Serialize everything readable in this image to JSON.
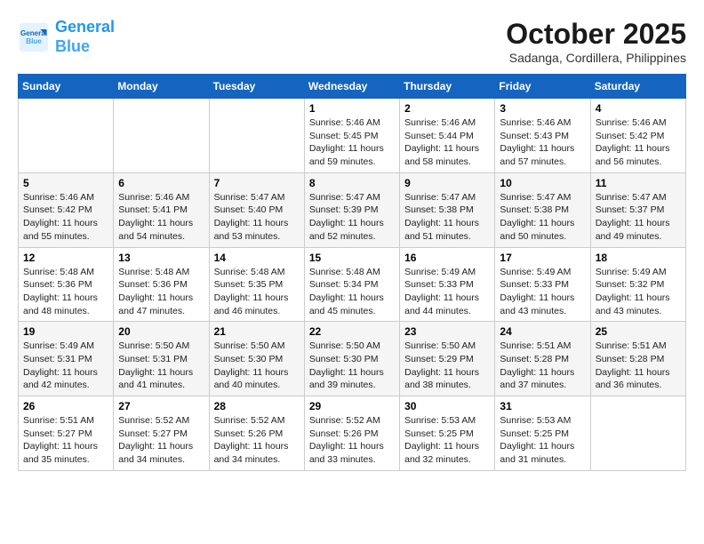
{
  "header": {
    "logo_line1": "General",
    "logo_line2": "Blue",
    "month": "October 2025",
    "location": "Sadanga, Cordillera, Philippines"
  },
  "weekdays": [
    "Sunday",
    "Monday",
    "Tuesday",
    "Wednesday",
    "Thursday",
    "Friday",
    "Saturday"
  ],
  "weeks": [
    [
      {
        "day": "",
        "info": ""
      },
      {
        "day": "",
        "info": ""
      },
      {
        "day": "",
        "info": ""
      },
      {
        "day": "1",
        "info": "Sunrise: 5:46 AM\nSunset: 5:45 PM\nDaylight: 11 hours\nand 59 minutes."
      },
      {
        "day": "2",
        "info": "Sunrise: 5:46 AM\nSunset: 5:44 PM\nDaylight: 11 hours\nand 58 minutes."
      },
      {
        "day": "3",
        "info": "Sunrise: 5:46 AM\nSunset: 5:43 PM\nDaylight: 11 hours\nand 57 minutes."
      },
      {
        "day": "4",
        "info": "Sunrise: 5:46 AM\nSunset: 5:42 PM\nDaylight: 11 hours\nand 56 minutes."
      }
    ],
    [
      {
        "day": "5",
        "info": "Sunrise: 5:46 AM\nSunset: 5:42 PM\nDaylight: 11 hours\nand 55 minutes."
      },
      {
        "day": "6",
        "info": "Sunrise: 5:46 AM\nSunset: 5:41 PM\nDaylight: 11 hours\nand 54 minutes."
      },
      {
        "day": "7",
        "info": "Sunrise: 5:47 AM\nSunset: 5:40 PM\nDaylight: 11 hours\nand 53 minutes."
      },
      {
        "day": "8",
        "info": "Sunrise: 5:47 AM\nSunset: 5:39 PM\nDaylight: 11 hours\nand 52 minutes."
      },
      {
        "day": "9",
        "info": "Sunrise: 5:47 AM\nSunset: 5:38 PM\nDaylight: 11 hours\nand 51 minutes."
      },
      {
        "day": "10",
        "info": "Sunrise: 5:47 AM\nSunset: 5:38 PM\nDaylight: 11 hours\nand 50 minutes."
      },
      {
        "day": "11",
        "info": "Sunrise: 5:47 AM\nSunset: 5:37 PM\nDaylight: 11 hours\nand 49 minutes."
      }
    ],
    [
      {
        "day": "12",
        "info": "Sunrise: 5:48 AM\nSunset: 5:36 PM\nDaylight: 11 hours\nand 48 minutes."
      },
      {
        "day": "13",
        "info": "Sunrise: 5:48 AM\nSunset: 5:36 PM\nDaylight: 11 hours\nand 47 minutes."
      },
      {
        "day": "14",
        "info": "Sunrise: 5:48 AM\nSunset: 5:35 PM\nDaylight: 11 hours\nand 46 minutes."
      },
      {
        "day": "15",
        "info": "Sunrise: 5:48 AM\nSunset: 5:34 PM\nDaylight: 11 hours\nand 45 minutes."
      },
      {
        "day": "16",
        "info": "Sunrise: 5:49 AM\nSunset: 5:33 PM\nDaylight: 11 hours\nand 44 minutes."
      },
      {
        "day": "17",
        "info": "Sunrise: 5:49 AM\nSunset: 5:33 PM\nDaylight: 11 hours\nand 43 minutes."
      },
      {
        "day": "18",
        "info": "Sunrise: 5:49 AM\nSunset: 5:32 PM\nDaylight: 11 hours\nand 43 minutes."
      }
    ],
    [
      {
        "day": "19",
        "info": "Sunrise: 5:49 AM\nSunset: 5:31 PM\nDaylight: 11 hours\nand 42 minutes."
      },
      {
        "day": "20",
        "info": "Sunrise: 5:50 AM\nSunset: 5:31 PM\nDaylight: 11 hours\nand 41 minutes."
      },
      {
        "day": "21",
        "info": "Sunrise: 5:50 AM\nSunset: 5:30 PM\nDaylight: 11 hours\nand 40 minutes."
      },
      {
        "day": "22",
        "info": "Sunrise: 5:50 AM\nSunset: 5:30 PM\nDaylight: 11 hours\nand 39 minutes."
      },
      {
        "day": "23",
        "info": "Sunrise: 5:50 AM\nSunset: 5:29 PM\nDaylight: 11 hours\nand 38 minutes."
      },
      {
        "day": "24",
        "info": "Sunrise: 5:51 AM\nSunset: 5:28 PM\nDaylight: 11 hours\nand 37 minutes."
      },
      {
        "day": "25",
        "info": "Sunrise: 5:51 AM\nSunset: 5:28 PM\nDaylight: 11 hours\nand 36 minutes."
      }
    ],
    [
      {
        "day": "26",
        "info": "Sunrise: 5:51 AM\nSunset: 5:27 PM\nDaylight: 11 hours\nand 35 minutes."
      },
      {
        "day": "27",
        "info": "Sunrise: 5:52 AM\nSunset: 5:27 PM\nDaylight: 11 hours\nand 34 minutes."
      },
      {
        "day": "28",
        "info": "Sunrise: 5:52 AM\nSunset: 5:26 PM\nDaylight: 11 hours\nand 34 minutes."
      },
      {
        "day": "29",
        "info": "Sunrise: 5:52 AM\nSunset: 5:26 PM\nDaylight: 11 hours\nand 33 minutes."
      },
      {
        "day": "30",
        "info": "Sunrise: 5:53 AM\nSunset: 5:25 PM\nDaylight: 11 hours\nand 32 minutes."
      },
      {
        "day": "31",
        "info": "Sunrise: 5:53 AM\nSunset: 5:25 PM\nDaylight: 11 hours\nand 31 minutes."
      },
      {
        "day": "",
        "info": ""
      }
    ]
  ]
}
